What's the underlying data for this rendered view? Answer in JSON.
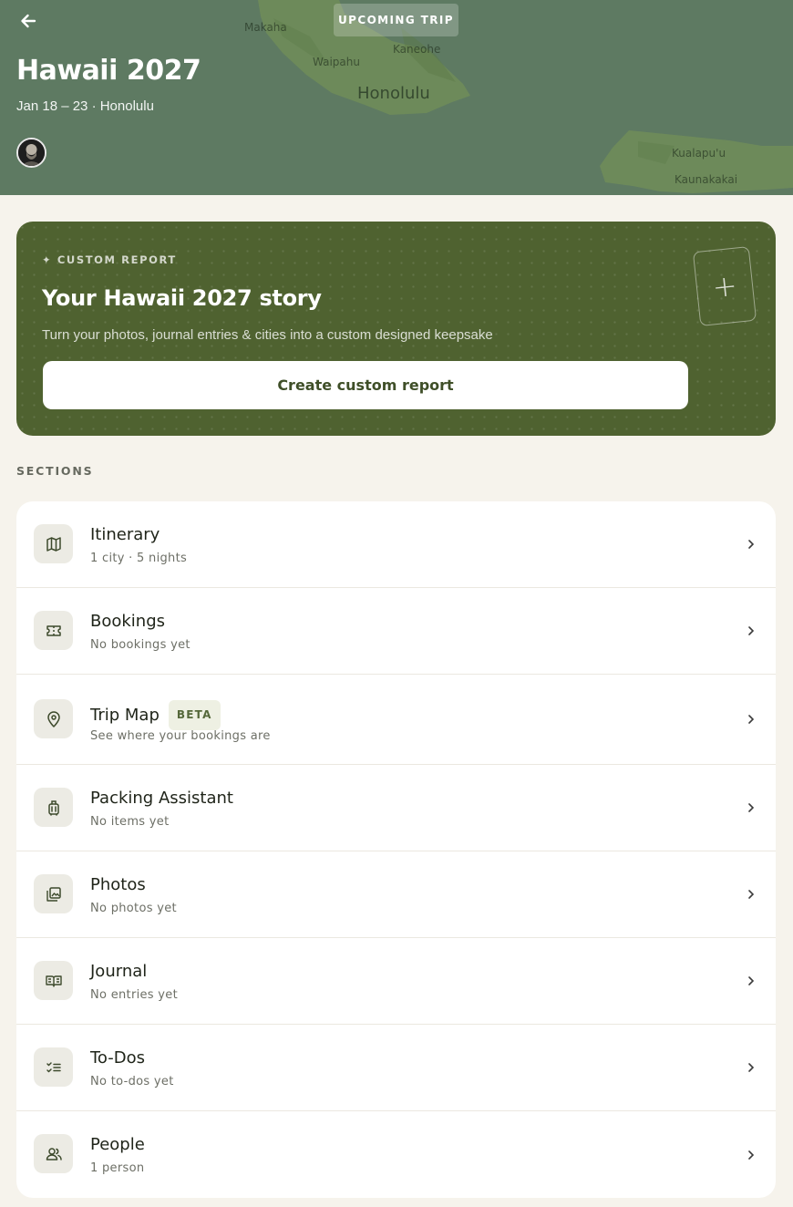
{
  "hero": {
    "badge": "UPCOMING TRIP",
    "title": "Hawaii 2027",
    "subtitle": "Jan 18 – 23 · Honolulu",
    "map_labels": {
      "makaha": "Makaha",
      "kaneohe": "Kaneohe",
      "waipahu": "Waipahu",
      "honolulu": "Honolulu",
      "kualapuu": "Kualapu'u",
      "kaunakakai": "Kaunakakai"
    },
    "icons": {
      "back": "arrow-left-icon",
      "avatar": "user-avatar"
    }
  },
  "report": {
    "kicker": "✦ CUSTOM REPORT",
    "title": "Your Hawaii 2027 story",
    "description": "Turn your photos, journal entries & cities into a custom designed keepsake",
    "button_label": "Create custom report",
    "add_symbol": "+"
  },
  "sections": {
    "label": "SECTIONS",
    "items": [
      {
        "title": "Itinerary",
        "subtitle": "1 city · 5 nights",
        "icon": "map-icon"
      },
      {
        "title": "Bookings",
        "subtitle": "No bookings yet",
        "icon": "ticket-icon"
      },
      {
        "title": "Trip Map",
        "badge": "BETA",
        "subtitle": "See where your bookings are",
        "icon": "location-pin-icon"
      },
      {
        "title": "Packing Assistant",
        "subtitle": "No items yet",
        "icon": "luggage-icon"
      },
      {
        "title": "Photos",
        "subtitle": "No photos yet",
        "icon": "photos-icon"
      },
      {
        "title": "Journal",
        "subtitle": "No entries yet",
        "icon": "book-icon"
      },
      {
        "title": "To-Dos",
        "subtitle": "No to-dos yet",
        "icon": "checklist-icon"
      },
      {
        "title": "People",
        "subtitle": "1 person",
        "icon": "people-icon"
      }
    ]
  },
  "colors": {
    "hero_bg": "#5e7a62",
    "card_bg": "#4f6230",
    "page_bg": "#f6f3ec",
    "accent_text": "#3f4f28"
  }
}
